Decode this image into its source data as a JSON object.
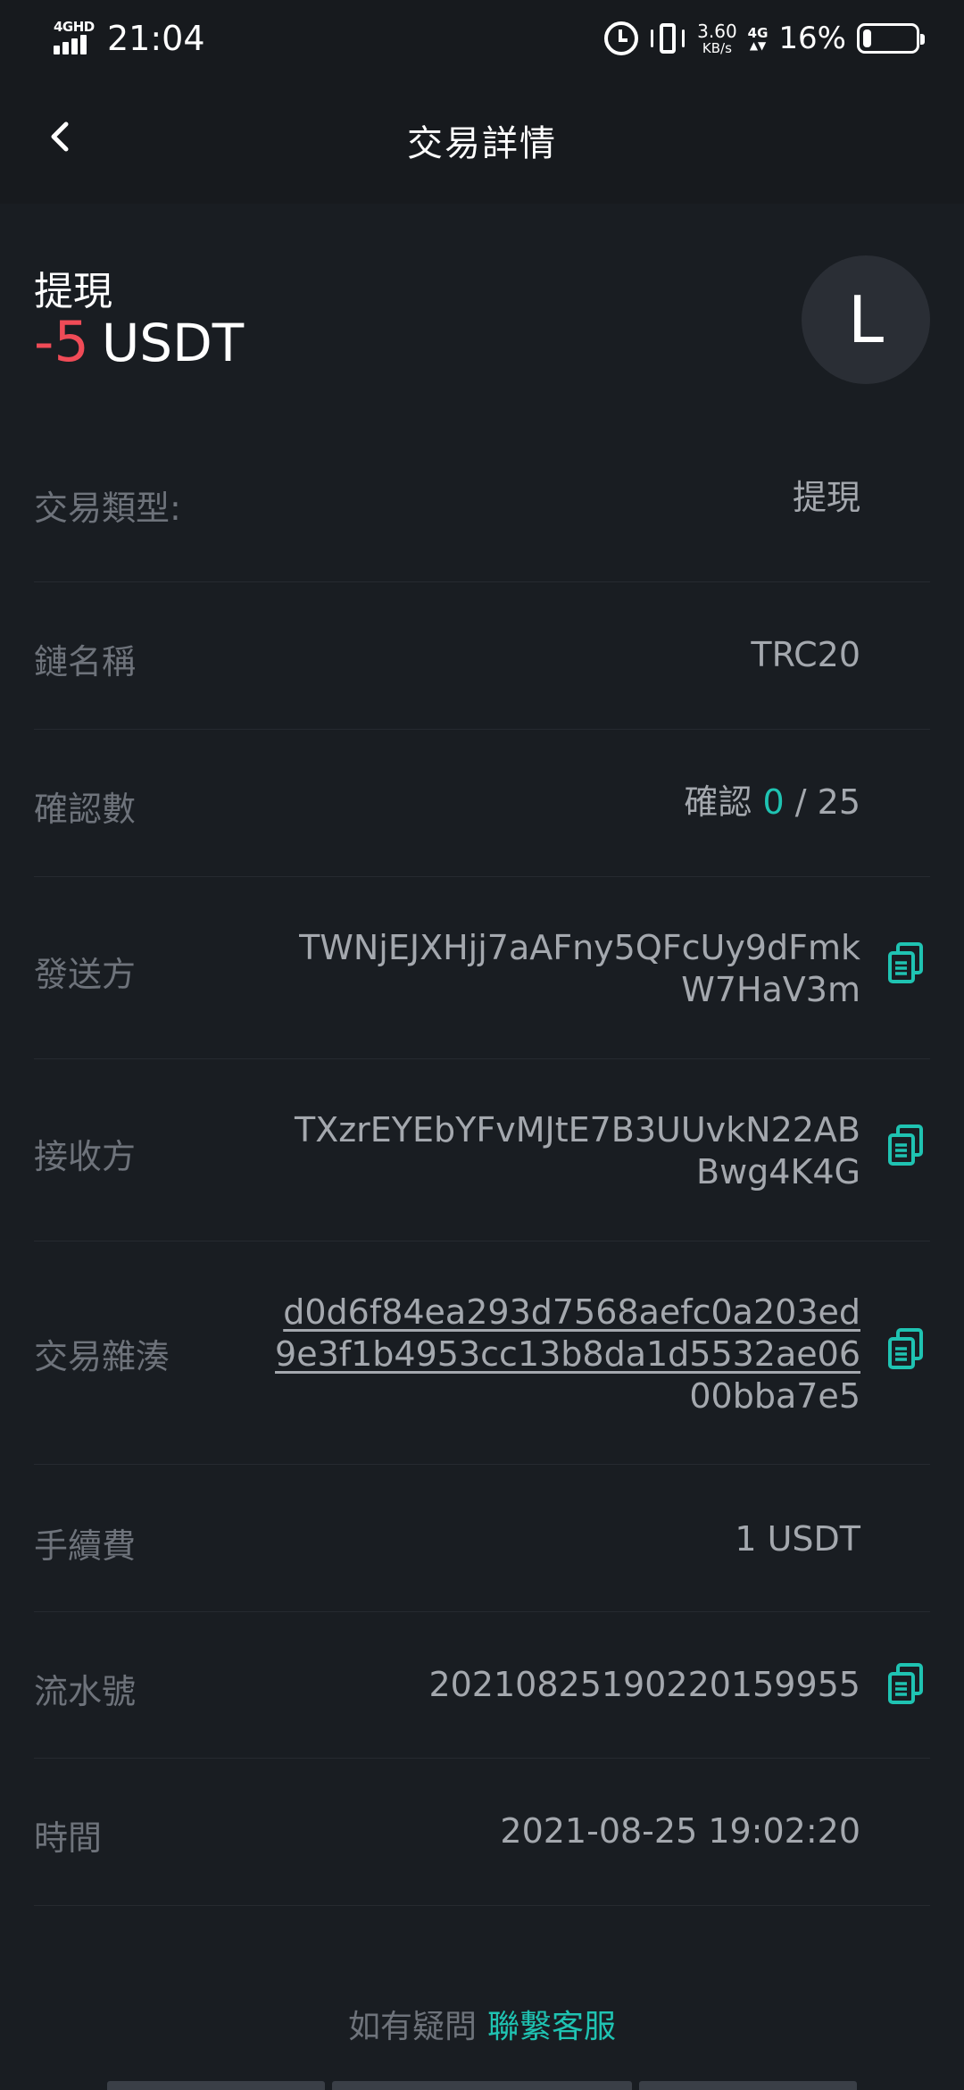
{
  "status_bar": {
    "network": "4GHD",
    "time": "21:04",
    "speed_value": "3.60",
    "speed_unit": "KB/s",
    "network2": "4G",
    "battery_percent": "16%",
    "battery_level": 0.16
  },
  "nav": {
    "title": "交易詳情"
  },
  "summary": {
    "type_title": "提現",
    "amount_value": "-5",
    "amount_unit": "USDT",
    "avatar_letter": "L"
  },
  "details": {
    "tx_type_label": "交易類型:",
    "tx_type_value": "提現",
    "chain_label": "鏈名稱",
    "chain_value": "TRC20",
    "confirm_label": "確認數",
    "confirm_prefix": "確認",
    "confirm_current": "0",
    "confirm_sep": "/",
    "confirm_total": "25",
    "sender_label": "發送方",
    "sender_value": "TWNjEJXHjj7aAFny5QFcUy9dFmkW7HaV3m",
    "receiver_label": "接收方",
    "receiver_value": "TXzrEYEbYFvMJtE7B3UUvkN22ABBwg4K4G",
    "hash_label": "交易雜湊",
    "hash_line1": "d0d6f84ea293d7568aefc0a203ed",
    "hash_line2": "9e3f1b4953cc13b8da1d5532ae06",
    "hash_line3": "00bba7e5",
    "fee_label": "手續費",
    "fee_value": "1 USDT",
    "serial_label": "流水號",
    "serial_value": "20210825190220159955",
    "time_label": "時間",
    "time_value": "2021-08-25 19:02:20"
  },
  "footer": {
    "question": "如有疑問",
    "contact_link": "聯繫客服"
  },
  "colors": {
    "background": "#191d22",
    "accent": "#1fc3b2",
    "negative": "#f04b57"
  },
  "icons": {
    "back": "chevron-left-icon",
    "copy": "copy-icon",
    "alarm": "alarm-icon",
    "vibrate": "vibrate-icon",
    "battery": "battery-icon"
  }
}
